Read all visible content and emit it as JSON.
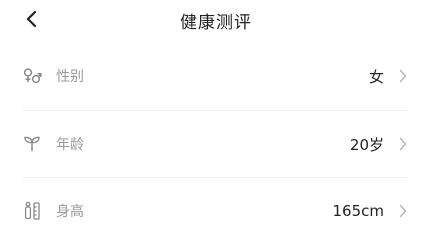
{
  "header": {
    "title": "健康测评",
    "back_icon": "chevron-left-icon"
  },
  "rows": [
    {
      "icon": "gender-icon",
      "label": "性别",
      "value": "女"
    },
    {
      "icon": "sprout-icon",
      "label": "年龄",
      "value": "20岁"
    },
    {
      "icon": "height-icon",
      "label": "身高",
      "value": "165cm"
    }
  ],
  "colors": {
    "label": "#9a9a9a",
    "value": "#222222",
    "icon": "#8a8a8a",
    "chevron": "#b5b5b5",
    "divider": "#efefef"
  }
}
